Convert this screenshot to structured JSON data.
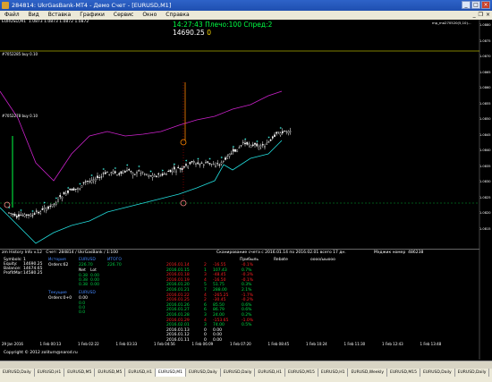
{
  "window": {
    "title": "284814: UkrGasBank-MT4 - Демо Счет - [EURUSD,M1]"
  },
  "menu": {
    "items": [
      "Файл",
      "Вид",
      "Вставка",
      "Графики",
      "Сервис",
      "Окно",
      "Справка"
    ]
  },
  "chart": {
    "symbol_line": "EURUSD,M1  1.0873 1.0873 1.0872 1.0872",
    "clock_line": "14:27:43 Плечо:100 Спред:2",
    "clock_value": "14690.25",
    "clock_value2": "0",
    "right_label": "mp_ma270520(5,10)...",
    "buy_label_1": "#7052285 buy 0.10",
    "buy_label_2": "#7052278 buy 0.10",
    "y_ticks": [
      "1.0880",
      "1.0875",
      "1.0870",
      "1.0865",
      "1.0860",
      "1.0855",
      "1.0850",
      "1.0845",
      "1.0840",
      "1.0835",
      "1.0830",
      "1.0825",
      "1.0820",
      "1.0815"
    ],
    "colors": {
      "candle": "#ffffff",
      "magenta": "#cc22cc",
      "cyan": "#22dddd",
      "green": "#00ff44",
      "orange": "#ff8800"
    }
  },
  "indicator": {
    "header": "zm History Info v.12   Счет: 284814 / UkrGasBank / 1:100",
    "scan_text": "Сканирование счета с 2016.01.14 по 2016.02.01 всего 17 дн.",
    "magic_text": "Мэджик номер  486238",
    "summary": {
      "labels": [
        "Symbols:",
        "Equity:",
        "Balance:",
        "ProfitMar:"
      ],
      "values": [
        "1",
        "14690.25",
        "14674.65",
        "14580.25"
      ]
    },
    "history_header": [
      "История",
      "EURUSD",
      "ИТОГО"
    ],
    "orders_label": "Orders:62",
    "orders_values": [
      "226.70",
      "226.70"
    ],
    "sub_labels": [
      "Net",
      "Lot"
    ],
    "sub_rows": [
      [
        "0.38",
        "0.00"
      ],
      [
        "0.38",
        "0.00"
      ],
      [
        "0.38",
        "0.00"
      ]
    ],
    "current_header": [
      "Текущие",
      "EURUSD"
    ],
    "current_orders": "Orders:0+0",
    "current_value": "0.00",
    "current_rows": [
      "0.0",
      "0.0",
      "0.0"
    ],
    "col_headers": [
      "Прибыль",
      "Rebate",
      "оооо/ыыооо"
    ],
    "rows": [
      {
        "date": "2016.01.14",
        "n": "2",
        "profit": "-16.55",
        "pct": "-0.1%"
      },
      {
        "date": "2016.01.15",
        "n": "1",
        "profit": "107.43",
        "pct": "0.7%"
      },
      {
        "date": "2016.01.18",
        "n": "3",
        "profit": "-48.45",
        "pct": "-0.3%"
      },
      {
        "date": "2016.01.19",
        "n": "4",
        "profit": "-16.50",
        "pct": "-0.1%"
      },
      {
        "date": "2016.01.20",
        "n": "5",
        "profit": "51.75",
        "pct": "0.3%"
      },
      {
        "date": "2016.01.21",
        "n": "7",
        "profit": "288.00",
        "pct": "2.1%"
      },
      {
        "date": "2016.01.22",
        "n": "4",
        "profit": "-265.25",
        "pct": "-1.7%"
      },
      {
        "date": "2016.01.25",
        "n": "2",
        "profit": "-30.45",
        "pct": "-0.2%"
      },
      {
        "date": "2016.01.26",
        "n": "6",
        "profit": "85.50",
        "pct": "0.6%"
      },
      {
        "date": "2016.01.27",
        "n": "6",
        "profit": "86.79",
        "pct": "0.6%"
      },
      {
        "date": "2016.01.28",
        "n": "3",
        "profit": "24.00",
        "pct": "0.2%"
      },
      {
        "date": "2016.01.29",
        "n": "4",
        "profit": "-153.65",
        "pct": "-1.0%"
      },
      {
        "date": "2016.02.01",
        "n": "3",
        "profit": "74.00",
        "pct": "0.5%"
      },
      {
        "date": "2016.01.13",
        "n": "0",
        "profit": "0.00",
        "pct": ""
      },
      {
        "date": "2016.01.12",
        "n": "0",
        "profit": "0.00",
        "pct": ""
      },
      {
        "date": "2016.01.11",
        "n": "0",
        "profit": "0.00",
        "pct": ""
      }
    ],
    "copyright": "Copyright © 2012 zoliturn@narod.ru"
  },
  "xaxis": {
    "ticks": [
      "29 Jan 2016",
      "1 Feb 00:13",
      "1 Feb 02:22",
      "1 Feb 03:33",
      "1 Feb 04:56",
      "1 Feb 06:09",
      "1 Feb 07:20",
      "1 Feb 08:45",
      "1 Feb 10:24",
      "1 Feb 11:30",
      "1 Feb 12:43",
      "1 Feb 13:48"
    ]
  },
  "tabs": {
    "items": [
      "EURUSD,Daily",
      "EURUSD,H1",
      "EURUSD,M5",
      "EURUSD,M5",
      "EURUSD,H1",
      "EURUSD,M1",
      "EURUSD,Daily",
      "EURUSD,Daily",
      "EURUSD,H1",
      "EURUSD,M15",
      "EURUSD,H1",
      "EURUSD,Weekly",
      "EURUSD,M15",
      "EURUSD,Daily",
      "EURUSD,Daily"
    ],
    "active_index": 5
  }
}
